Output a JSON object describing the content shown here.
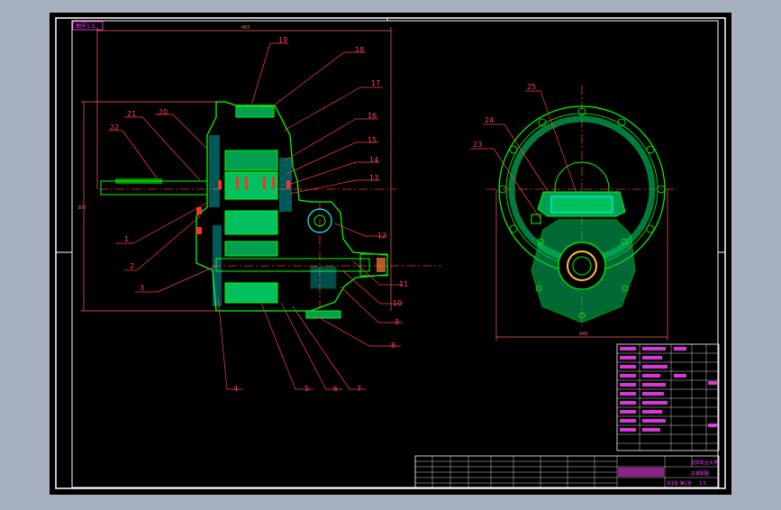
{
  "colors": {
    "background": "#a7b0bf",
    "paper": "#000000",
    "frame": "#ffffff",
    "outline": "#00ff00",
    "section": "#00ffff",
    "leader": "#ff4040",
    "dim": "#ff6060",
    "gear": "#00c060",
    "centerline": "#ff3030",
    "bolt": "#ff60ff",
    "label": "#ff4060",
    "tableText": "#ff40ff"
  },
  "drawing": {
    "corner_tag": "图号1:5",
    "overall_width_dim": "465",
    "overall_height_dim": "300",
    "side_width_dim": "440",
    "part_numbers": [
      "1",
      "2",
      "3",
      "4",
      "5",
      "6",
      "7",
      "8",
      "9",
      "10",
      "11",
      "12",
      "13",
      "14",
      "15",
      "16",
      "17",
      "18",
      "19",
      "20",
      "21",
      "22",
      "23",
      "24",
      "25"
    ]
  },
  "title_block": {
    "school": "沈阳农业大学",
    "drawing_name": "总装配图",
    "scale": "1:5",
    "sheet": "共1张 第1张"
  }
}
